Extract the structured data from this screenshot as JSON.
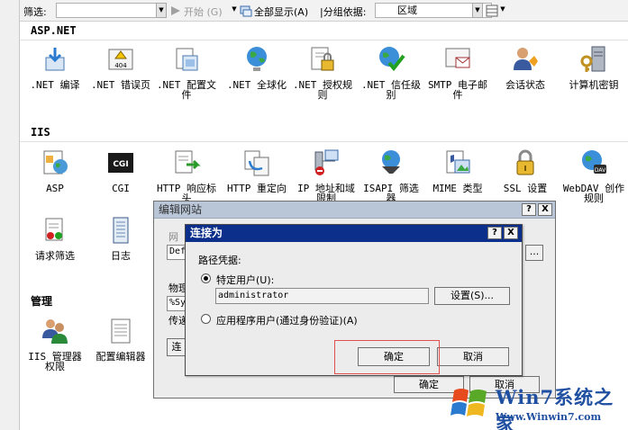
{
  "toolbar": {
    "filter_label": "筛选:",
    "start_label": "开始",
    "start_key": "(G)",
    "show_all_label": "全部显示(A)",
    "group_label": "|分组依据:",
    "group_value": "区域"
  },
  "sections": {
    "aspnet": "ASP.NET",
    "iis": "IIS",
    "management": "管理"
  },
  "aspnet_items": [
    ".NET 编译",
    ".NET 错误页",
    ".NET 配置文\n件",
    ".NET 全球化",
    ".NET 授权规\n则",
    ".NET 信任级\n别",
    "SMTP 电子邮\n件",
    "会话状态",
    "计算机密钥"
  ],
  "iis_items": [
    "ASP",
    "CGI",
    "HTTP 响应标\n头",
    "HTTP 重定向",
    "IP 地址和域\n限制",
    "ISAPI 筛选\n器",
    "MIME 类型",
    "SSL 设置",
    "WebDAV 创作\n规则"
  ],
  "iis_items_row2": [
    "请求筛选",
    "日志"
  ],
  "management_items": [
    "IIS 管理器\n权限",
    "配置编辑器"
  ],
  "icon_badges": {
    "error_page": "404",
    "cgi": "CGI",
    "webdav": "DAV"
  },
  "edit_site_dialog": {
    "title": "编辑网站",
    "help": "?",
    "close": "X",
    "frag_site": "网",
    "field_site": "Def",
    "frag_phys": "物理",
    "field_path": "%Sy",
    "frag_pass": "传递",
    "connect_btn": "连",
    "ellipsis_btn": "...",
    "ok_btn": "确定",
    "cancel_btn": "取消"
  },
  "connect_as_dialog": {
    "title": "连接为",
    "help": "?",
    "close": "X",
    "path_credentials": "路径凭据:",
    "specific_user_label": "特定用户(U):",
    "username": "administrator",
    "set_button": "设置(S)...",
    "app_user_label": "应用程序用户(通过身份验证)(A)",
    "ok_button": "确定",
    "cancel_button": "取消"
  },
  "watermark": {
    "title": "Win7系统之家",
    "url": "Www.Winwin7.com"
  },
  "colors": {
    "active_title": "#0b2f8a",
    "inactive_title": "#b8c6d8",
    "highlight_box": "#e05050",
    "watermark": "#1f4fa0"
  }
}
